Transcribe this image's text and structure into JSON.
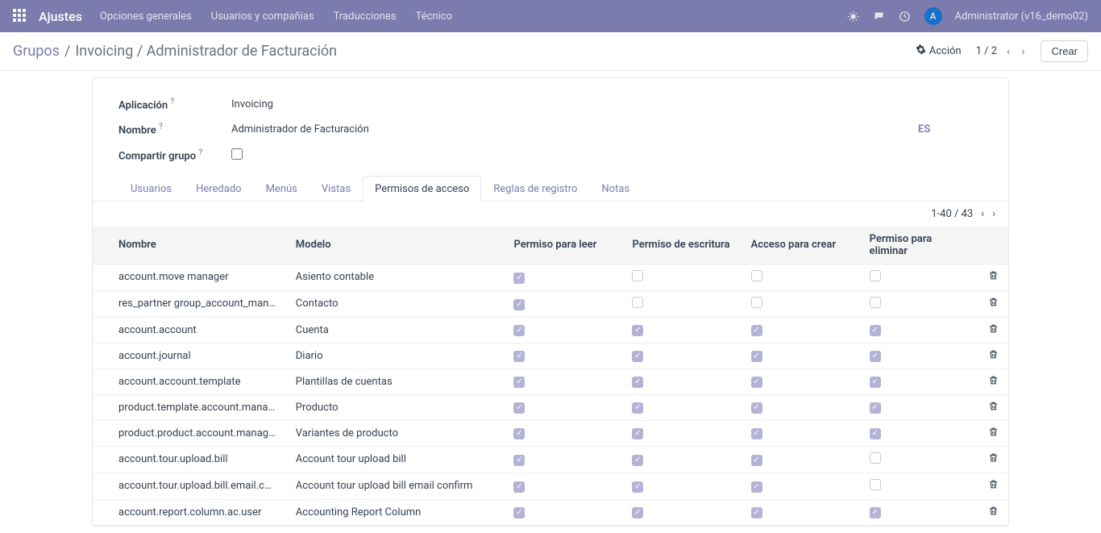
{
  "nav": {
    "brand": "Ajustes",
    "menu": [
      "Opciones generales",
      "Usuarios y compañías",
      "Traducciones",
      "Técnico"
    ],
    "avatar_letter": "A",
    "username": "Administrator (v16_demo02)"
  },
  "breadcrumb": {
    "root": "Grupos",
    "path": "Invoicing / Administrador de Facturación"
  },
  "cp": {
    "action_label": "Acción",
    "pager": "1 / 2",
    "create": "Crear"
  },
  "form": {
    "app_label": "Aplicación",
    "app_value": "Invoicing",
    "name_label": "Nombre",
    "name_value": "Administrador de Facturación",
    "lang": "ES",
    "share_label": "Compartir grupo",
    "share_checked": false
  },
  "tabs": [
    "Usuarios",
    "Heredado",
    "Menús",
    "Vistas",
    "Permisos de acceso",
    "Reglas de registro",
    "Notas"
  ],
  "active_tab_index": 4,
  "inner_pager": "1-40 / 43",
  "table": {
    "headers": [
      "Nombre",
      "Modelo",
      "Permiso para leer",
      "Permiso de escritura",
      "Acceso para crear",
      "Permiso para eliminar"
    ],
    "rows": [
      {
        "name": "account.move manager",
        "model": "Asiento contable",
        "r": true,
        "w": false,
        "c": false,
        "d": false
      },
      {
        "name": "res_partner group_account_mana…",
        "model": "Contacto",
        "r": true,
        "w": false,
        "c": false,
        "d": false
      },
      {
        "name": "account.account",
        "model": "Cuenta",
        "r": true,
        "w": true,
        "c": true,
        "d": true
      },
      {
        "name": "account.journal",
        "model": "Diario",
        "r": true,
        "w": true,
        "c": true,
        "d": true
      },
      {
        "name": "account.account.template",
        "model": "Plantillas de cuentas",
        "r": true,
        "w": true,
        "c": true,
        "d": true
      },
      {
        "name": "product.template.account.manager",
        "model": "Producto",
        "r": true,
        "w": true,
        "c": true,
        "d": true
      },
      {
        "name": "product.product.account.manager",
        "model": "Variantes de producto",
        "r": true,
        "w": true,
        "c": true,
        "d": true
      },
      {
        "name": "account.tour.upload.bill",
        "model": "Account tour upload bill",
        "r": true,
        "w": true,
        "c": true,
        "d": false
      },
      {
        "name": "account.tour.upload.bill.email.conf…",
        "model": "Account tour upload bill email confirm",
        "r": true,
        "w": true,
        "c": true,
        "d": false
      },
      {
        "name": "account.report.column.ac.user",
        "model": "Accounting Report Column",
        "r": true,
        "w": true,
        "c": true,
        "d": true
      }
    ]
  }
}
